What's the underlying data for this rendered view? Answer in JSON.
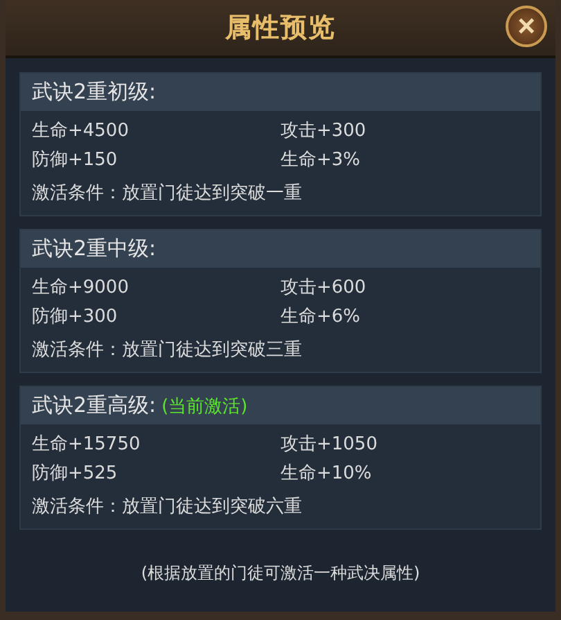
{
  "window": {
    "title": "属性预览",
    "close": "×"
  },
  "tiers": [
    {
      "title": "武诀2重初级:",
      "stats": [
        "生命+4500",
        "攻击+300",
        "防御+150",
        "生命+3%"
      ],
      "condition": "激活条件：放置门徒达到突破一重"
    },
    {
      "title": "武诀2重中级:",
      "stats": [
        "生命+9000",
        "攻击+600",
        "防御+300",
        "生命+6%"
      ],
      "condition": "激活条件：放置门徒达到突破三重"
    },
    {
      "title": "武诀2重高级:",
      "status": "(当前激活)",
      "stats": [
        "生命+15750",
        "攻击+1050",
        "防御+525",
        "生命+10%"
      ],
      "condition": "激活条件：放置门徒达到突破六重"
    }
  ],
  "footnote": "(根据放置的门徒可激活一种武决属性)"
}
